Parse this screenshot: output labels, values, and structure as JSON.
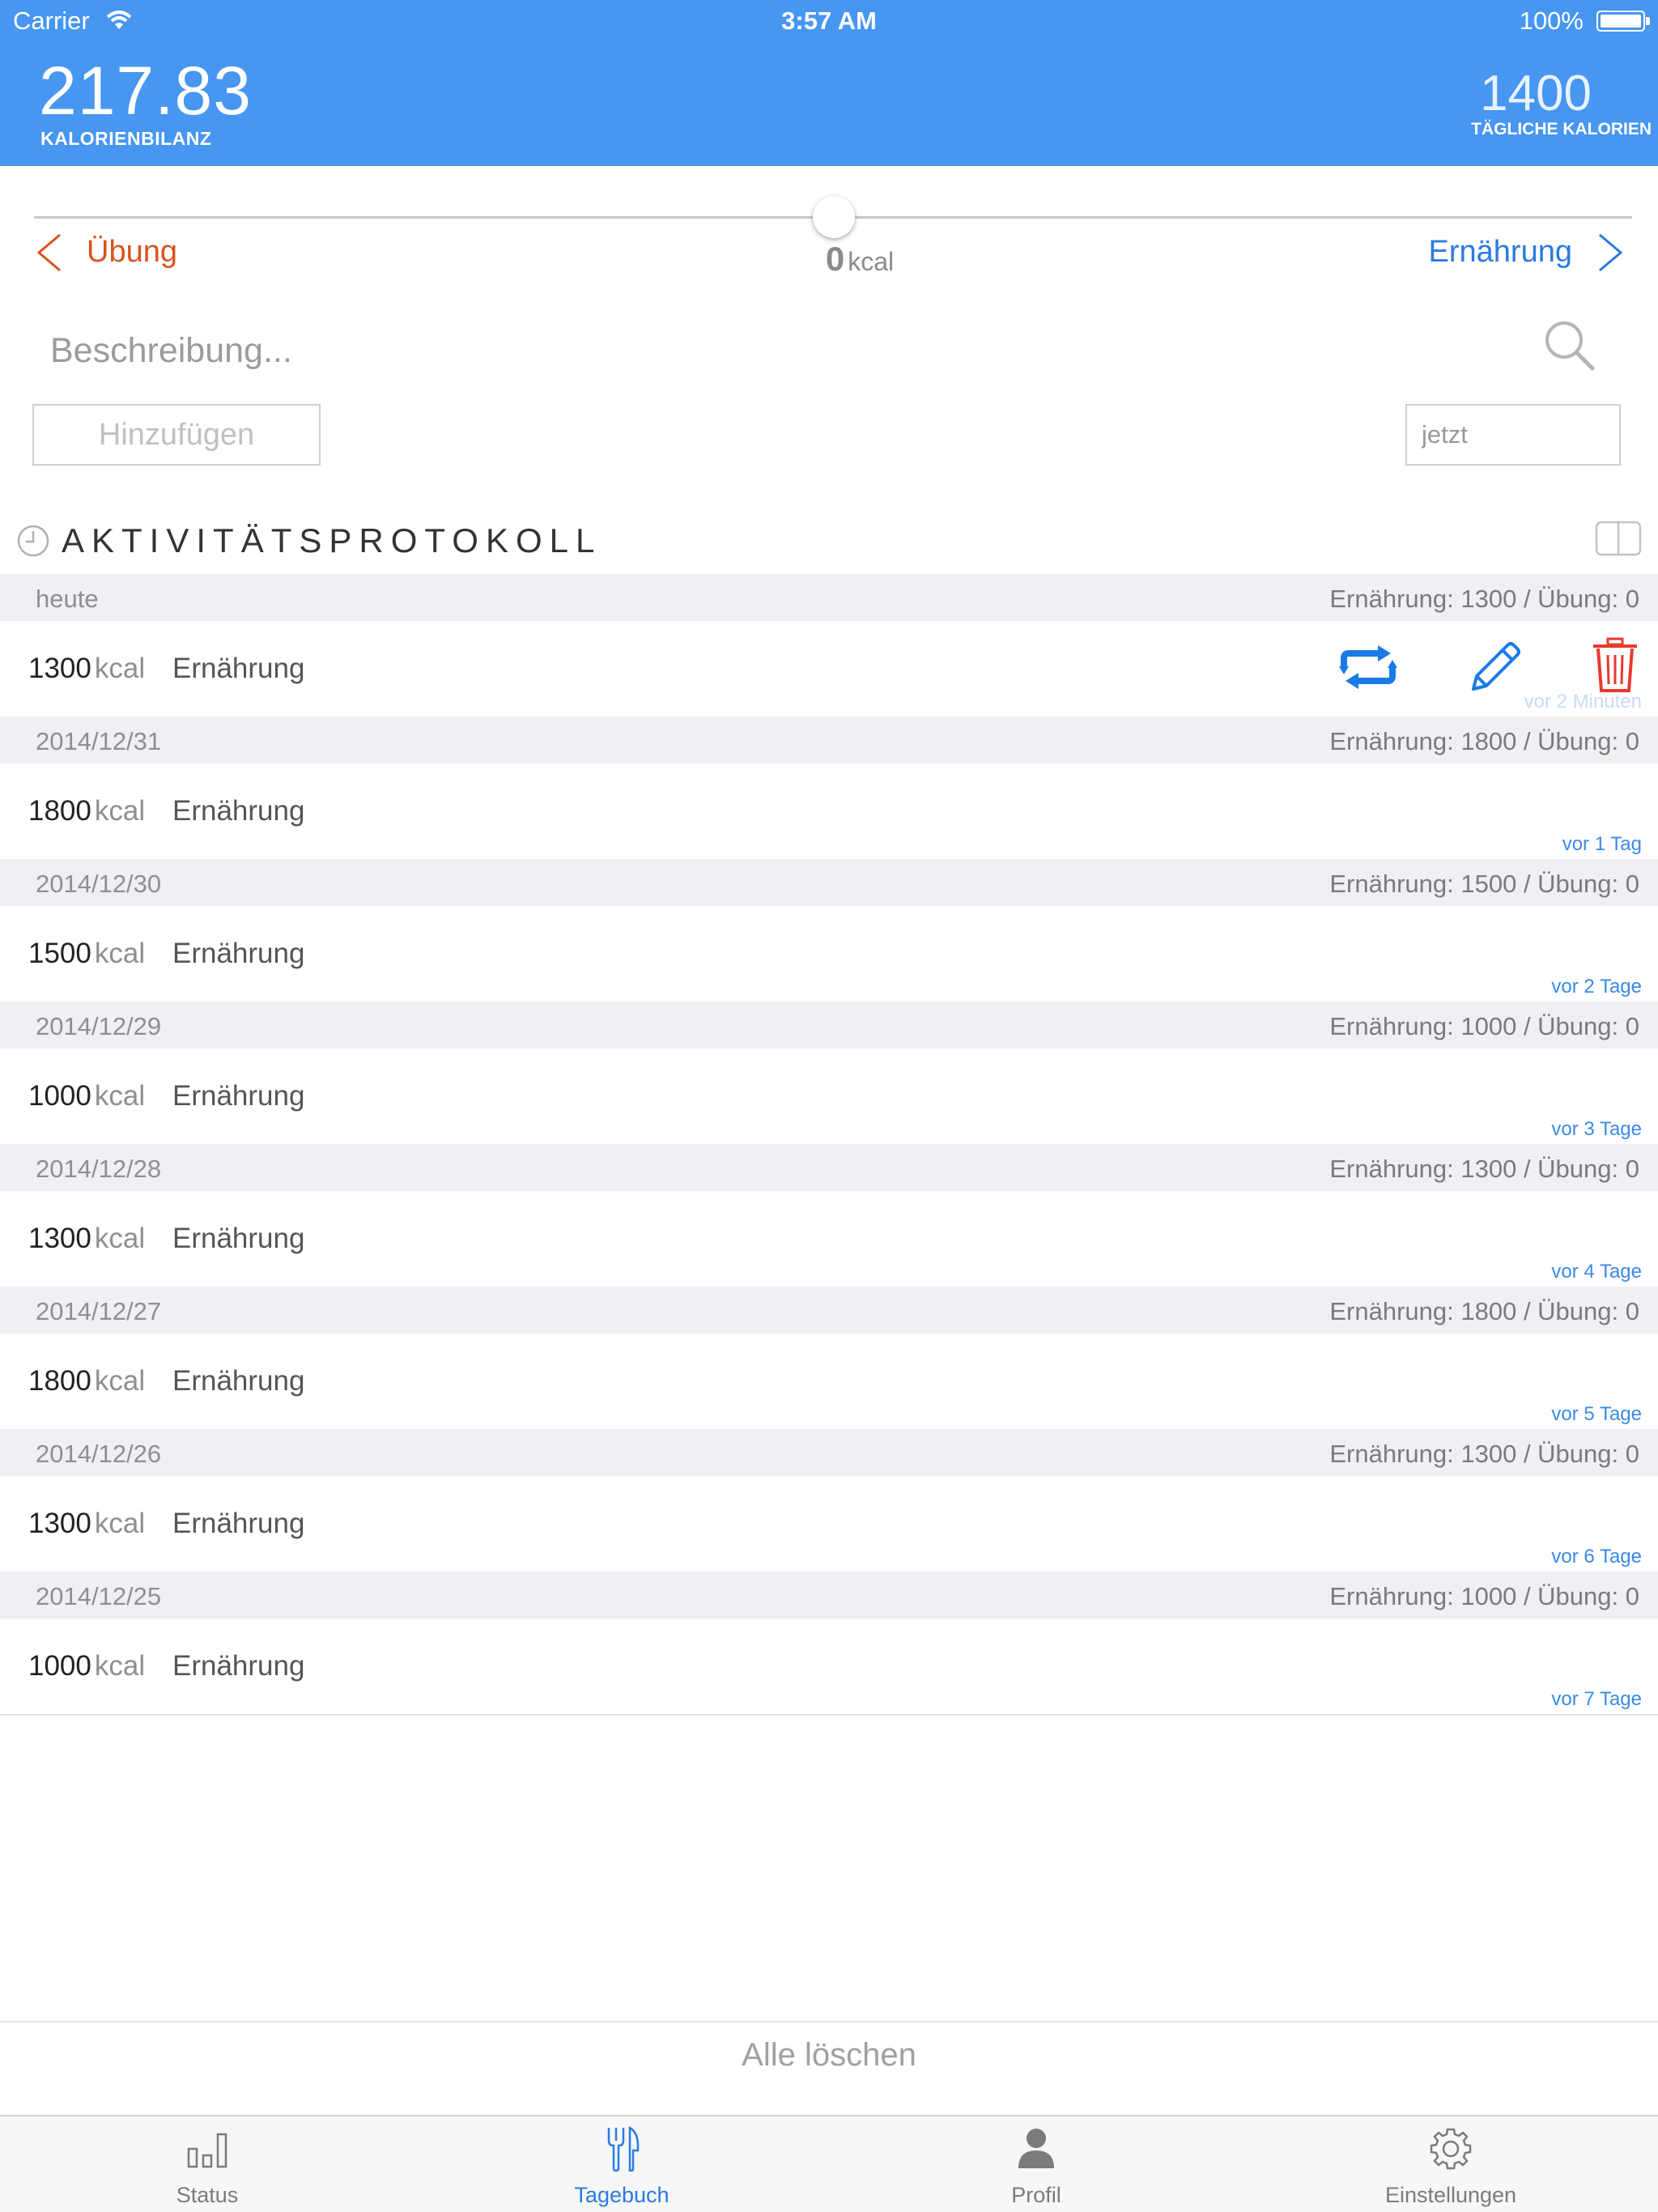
{
  "status_bar": {
    "carrier": "Carrier",
    "time": "3:57 AM",
    "battery": "100%"
  },
  "header": {
    "balance_value": "217.83",
    "balance_label": "KALORIENBILANZ",
    "daily_value": "1400",
    "daily_label": "TÄGLICHE KALORIEN"
  },
  "slider": {
    "prev_label": "Übung",
    "next_label": "Ernährung",
    "value": "0",
    "unit": "kcal"
  },
  "form": {
    "description_placeholder": "Beschreibung...",
    "add_label": "Hinzufügen",
    "time_placeholder": "jetzt"
  },
  "log": {
    "title": "AKTIVITÄTSPROTOKOLL",
    "days": [
      {
        "date": "heute",
        "summary": "Ernährung: 1300 / Übung: 0",
        "kcal": "1300",
        "unit": "kcal",
        "type": "Ernährung",
        "ago": "vor 2 Minuten"
      },
      {
        "date": "2014/12/31",
        "summary": "Ernährung: 1800 / Übung: 0",
        "kcal": "1800",
        "unit": "kcal",
        "type": "Ernährung",
        "ago": "vor 1 Tag"
      },
      {
        "date": "2014/12/30",
        "summary": "Ernährung: 1500 / Übung: 0",
        "kcal": "1500",
        "unit": "kcal",
        "type": "Ernährung",
        "ago": "vor 2 Tage"
      },
      {
        "date": "2014/12/29",
        "summary": "Ernährung: 1000 / Übung: 0",
        "kcal": "1000",
        "unit": "kcal",
        "type": "Ernährung",
        "ago": "vor 3 Tage"
      },
      {
        "date": "2014/12/28",
        "summary": "Ernährung: 1300 / Übung: 0",
        "kcal": "1300",
        "unit": "kcal",
        "type": "Ernährung",
        "ago": "vor 4 Tage"
      },
      {
        "date": "2014/12/27",
        "summary": "Ernährung: 1800 / Übung: 0",
        "kcal": "1800",
        "unit": "kcal",
        "type": "Ernährung",
        "ago": "vor 5 Tage"
      },
      {
        "date": "2014/12/26",
        "summary": "Ernährung: 1300 / Übung: 0",
        "kcal": "1300",
        "unit": "kcal",
        "type": "Ernährung",
        "ago": "vor 6 Tage"
      },
      {
        "date": "2014/12/25",
        "summary": "Ernährung: 1000 / Übung: 0",
        "kcal": "1000",
        "unit": "kcal",
        "type": "Ernährung",
        "ago": "vor 7 Tage"
      }
    ]
  },
  "clear_all_label": "Alle löschen",
  "tabs": [
    {
      "label": "Status",
      "icon": "bar-chart-icon"
    },
    {
      "label": "Tagebuch",
      "icon": "fork-knife-icon",
      "active": true
    },
    {
      "label": "Profil",
      "icon": "person-icon"
    },
    {
      "label": "Einstellungen",
      "icon": "gear-icon"
    }
  ],
  "colors": {
    "header": "#4796f0",
    "accent": "#2a7be4",
    "exercise": "#d9531e",
    "delete": "#e8392f"
  }
}
